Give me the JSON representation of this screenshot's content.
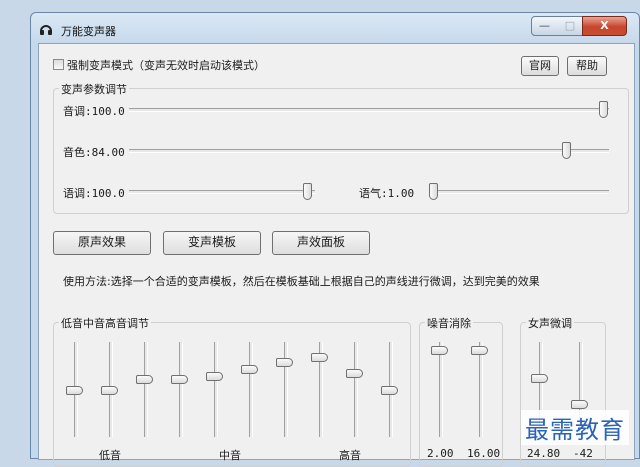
{
  "window": {
    "title": "万能变声器",
    "controls": {
      "minimize": "—",
      "maximize": "□",
      "close": "X"
    }
  },
  "top": {
    "force_mode_label": "强制变声模式（变声无效时启动该模式）",
    "force_mode_checked": false,
    "official_site_label": "官网",
    "help_label": "帮助"
  },
  "params": {
    "group_label": "变声参数调节",
    "pitch_label": "音调:100.0",
    "pitch_value": 100.0,
    "timbre_label": "音色:84.00",
    "timbre_value": 84.0,
    "speed_label": "语调:100.0",
    "speed_value": 100.0,
    "tone_label": "语气:1.00",
    "tone_value": 1.0
  },
  "buttons": {
    "original": "原声效果",
    "templates": "变声模板",
    "panel": "声效面板"
  },
  "usage_text": "使用方法:选择一个合适的变声模板，然后在模板基础上根据自己的声线进行微调，达到完美的效果",
  "eq": {
    "group_label": "低音中音高音调节",
    "bands": [
      "低音",
      "中音",
      "高音"
    ]
  },
  "noise": {
    "group_label": "噪音消除",
    "values": [
      "2.00",
      "16.00"
    ]
  },
  "female": {
    "group_label": "女声微调",
    "values": [
      "24.80",
      "-42"
    ]
  },
  "watermark": "最需教育",
  "icons": {
    "app": "headphones-icon"
  }
}
